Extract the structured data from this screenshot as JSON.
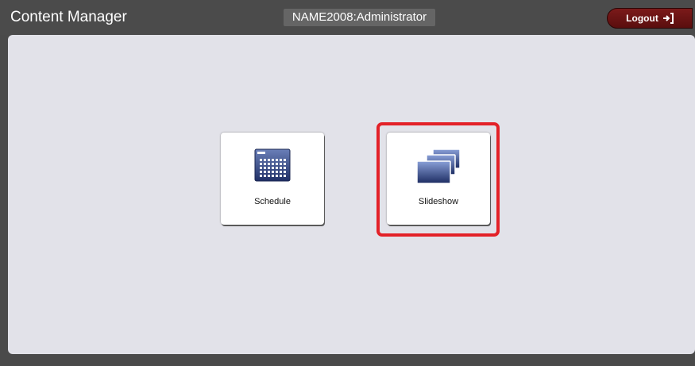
{
  "header": {
    "app_title": "Content Manager",
    "user": "NAME2008:Administrator",
    "logout_label": "Logout"
  },
  "tiles": [
    {
      "label": "Schedule",
      "icon": "calendar-icon"
    },
    {
      "label": "Slideshow",
      "icon": "slideshow-icon"
    }
  ],
  "colors": {
    "header_bg": "#4b4b4b",
    "panel_bg": "#e2e2e9",
    "logout_bg": "#6a1414",
    "highlight": "#e32128",
    "icon_blue": "#2b3f7a"
  }
}
